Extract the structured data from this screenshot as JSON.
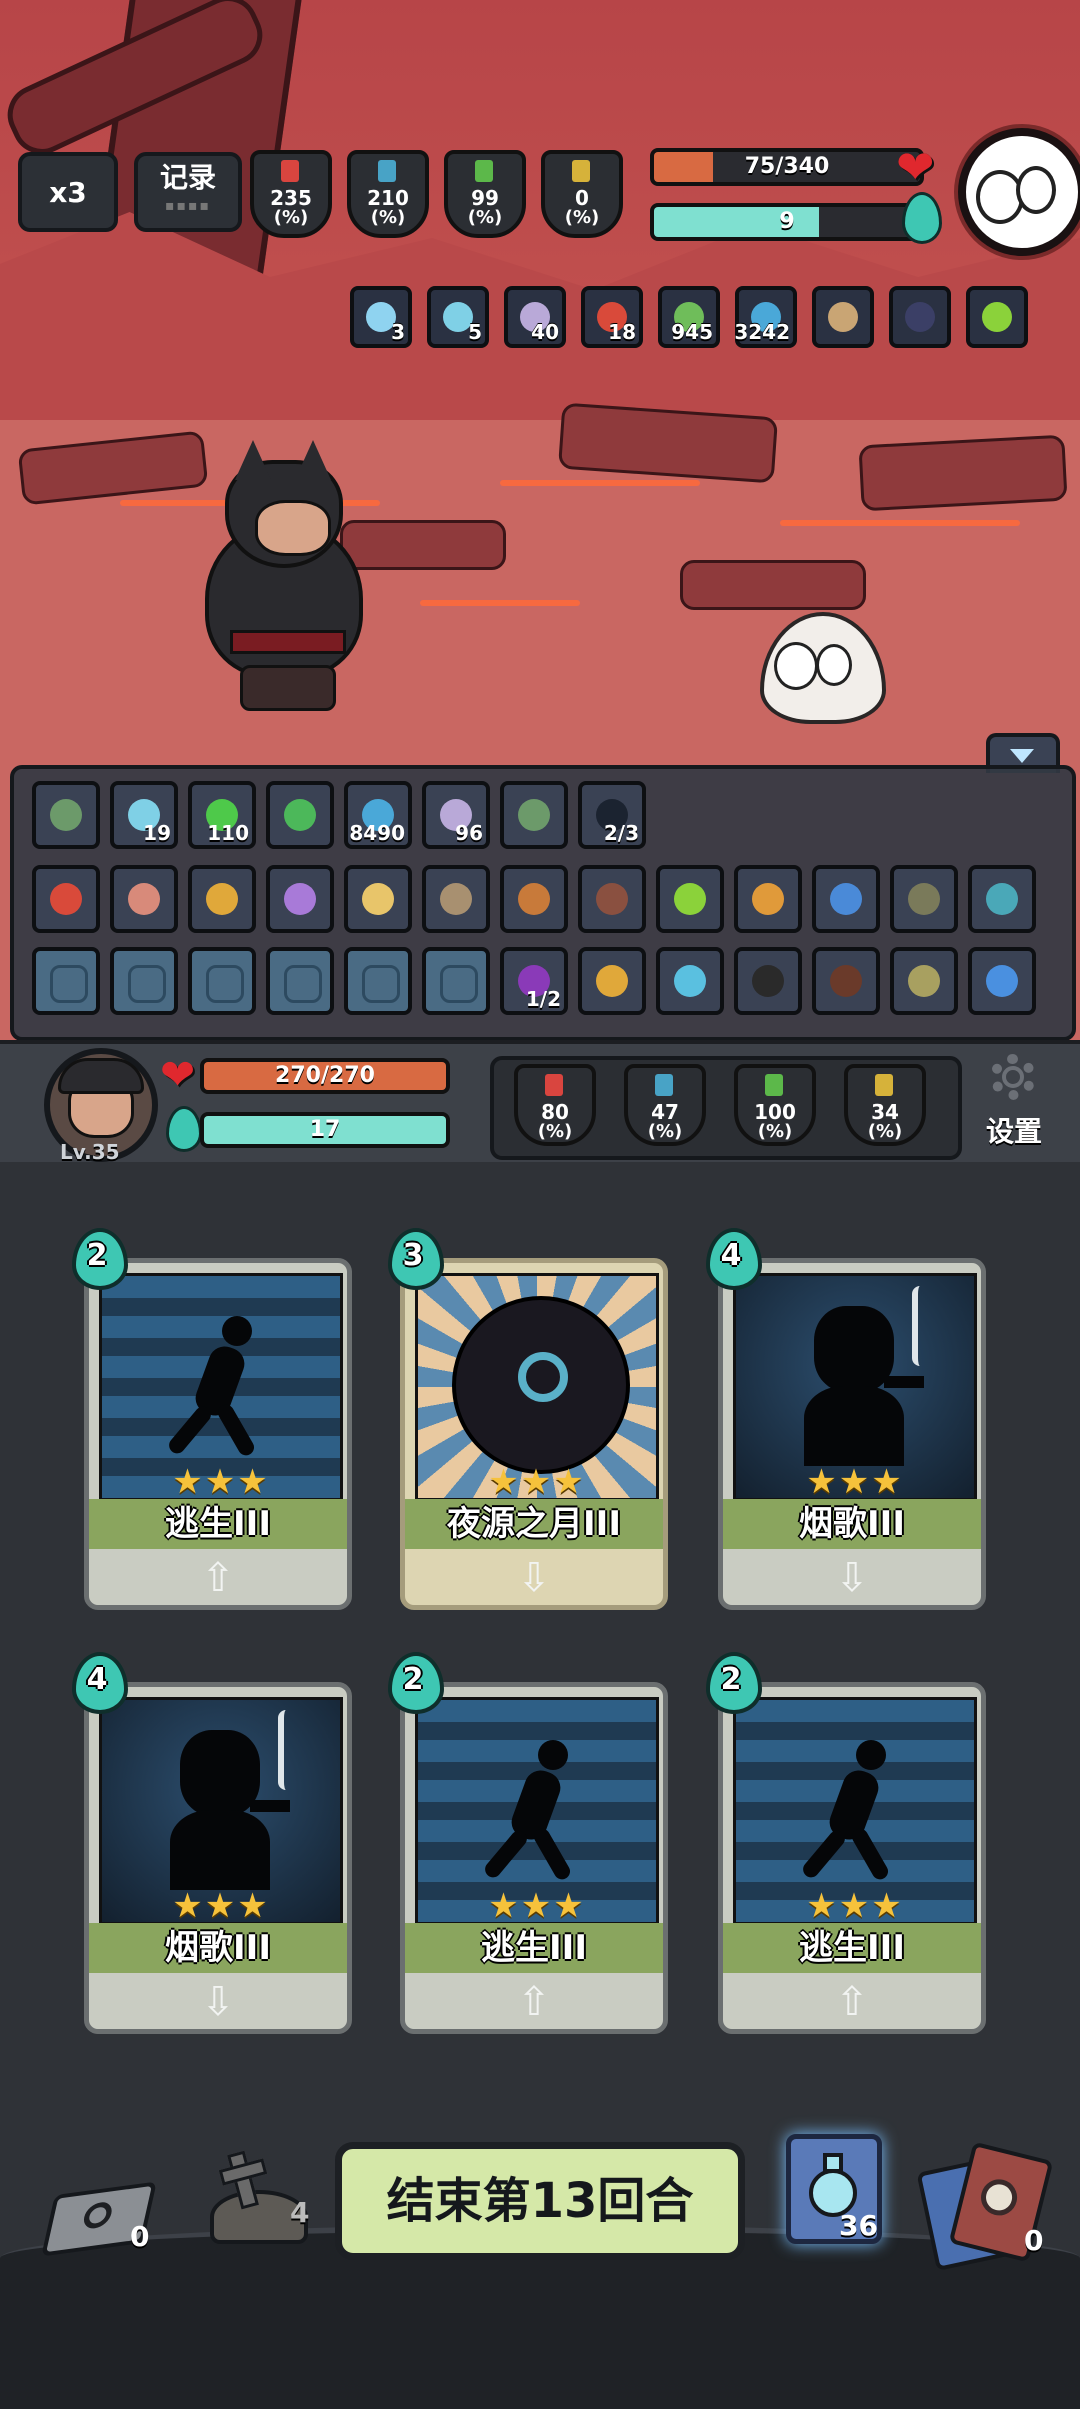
{
  "enemy": {
    "speed_button": "x3",
    "record_button": "记录",
    "stats": [
      {
        "value": "235",
        "unit": "(%)",
        "color": "#d9453f",
        "icon": "attack-icon"
      },
      {
        "value": "210",
        "unit": "(%)",
        "color": "#48a3c6",
        "icon": "crit-icon"
      },
      {
        "value": "99",
        "unit": "(%)",
        "color": "#5cb84a",
        "icon": "defense-icon"
      },
      {
        "value": "0",
        "unit": "(%)",
        "color": "#d6b23a",
        "icon": "speed-icon"
      }
    ],
    "hp": {
      "text": "75/340",
      "current": 75,
      "max": 340
    },
    "energy": {
      "text": "9",
      "fraction": 0.62
    },
    "buffs": [
      {
        "icon": "snowflake-icon",
        "count": "3",
        "color": "#8fd3f0"
      },
      {
        "icon": "crosshair-icon",
        "count": "5",
        "color": "#7fd0e6"
      },
      {
        "icon": "swirl-icon",
        "count": "40",
        "color": "#b9a9d8"
      },
      {
        "icon": "claw-icon",
        "count": "18",
        "color": "#d94a3a"
      },
      {
        "icon": "skull-icon",
        "count": "945",
        "color": "#6fbd5a"
      },
      {
        "icon": "shield-icon",
        "count": "3242",
        "color": "#4aa8d8"
      },
      {
        "icon": "scroll-icon",
        "count": "",
        "color": "#c9a574"
      },
      {
        "icon": "cloak-icon",
        "count": "",
        "color": "#3b3f66"
      },
      {
        "icon": "leaf-icon",
        "count": "",
        "color": "#8bd23a"
      }
    ]
  },
  "inventory": {
    "row1": [
      {
        "icon": "turtle-shell-icon",
        "count": "",
        "color": "#6c9a6a"
      },
      {
        "icon": "crosshair-icon",
        "count": "19",
        "color": "#7fd0e6"
      },
      {
        "icon": "green-blade-icon",
        "count": "110",
        "color": "#4ec94a"
      },
      {
        "icon": "green-glove-icon",
        "count": "",
        "color": "#4cb85a"
      },
      {
        "icon": "shield-icon",
        "count": "8490",
        "color": "#4aa8d8"
      },
      {
        "icon": "swirl-icon",
        "count": "96",
        "color": "#b9a9d8"
      },
      {
        "icon": "turtle-shell-icon",
        "count": "",
        "color": "#6c9a6a"
      },
      {
        "icon": "shadow-figure-icon",
        "count": "2/3",
        "color": "#1b2330"
      }
    ],
    "row2": [
      {
        "icon": "red-horn-icon",
        "color": "#d94a3a"
      },
      {
        "icon": "meat-icon",
        "color": "#d88a7a"
      },
      {
        "icon": "golden-horn-icon",
        "color": "#e0a83a"
      },
      {
        "icon": "crystals-icon",
        "color": "#a87ad8"
      },
      {
        "icon": "potion-bottle-icon",
        "color": "#e8c56a"
      },
      {
        "icon": "fossil-icon",
        "color": "#a89070"
      },
      {
        "icon": "cookie-icon",
        "color": "#c87a3a"
      },
      {
        "icon": "fang-icon",
        "color": "#8a5040"
      },
      {
        "icon": "leaf-icon",
        "color": "#8bd23a"
      },
      {
        "icon": "broom-icon",
        "color": "#e09a3a"
      },
      {
        "icon": "blue-horn-icon",
        "color": "#4a8ad8"
      },
      {
        "icon": "spiked-ball-icon",
        "color": "#7a7a5a"
      },
      {
        "icon": "fish-icon",
        "color": "#4aa8b8"
      }
    ],
    "row3": [
      {
        "icon": "ghost-icon",
        "count": "",
        "color": "#4a6b84"
      },
      {
        "icon": "muscle-icon",
        "count": "",
        "color": "#4a6b84"
      },
      {
        "icon": "pig-icon",
        "count": "",
        "color": "#4a6b84"
      },
      {
        "icon": "potion-icon",
        "count": "",
        "color": "#4a6b84"
      },
      {
        "icon": "skull-shield-icon",
        "count": "",
        "color": "#4a6b84"
      },
      {
        "icon": "skull-icon",
        "count": "",
        "color": "#4a6b84"
      },
      {
        "icon": "witch-icon",
        "count": "1/2",
        "color": "#8a3ab8"
      },
      {
        "icon": "flower-icon",
        "count": "",
        "color": "#e0a83a"
      },
      {
        "icon": "water-drop-icon",
        "count": "",
        "color": "#5ac0e0"
      },
      {
        "icon": "trap-icon",
        "count": "",
        "color": "#2a2a2a"
      },
      {
        "icon": "sack-icon",
        "count": "",
        "color": "#6a3a2a"
      },
      {
        "icon": "egg-icon",
        "count": "",
        "color": "#a8a060"
      },
      {
        "icon": "rune-stone-icon",
        "count": "",
        "color": "#4a90e0"
      }
    ]
  },
  "player": {
    "level": "Lv.35",
    "hp": {
      "text": "270/270",
      "current": 270,
      "max": 270
    },
    "energy": {
      "text": "17",
      "fraction": 1.0
    },
    "stats": [
      {
        "value": "80",
        "unit": "(%)",
        "color": "#d9453f",
        "icon": "attack-icon"
      },
      {
        "value": "47",
        "unit": "(%)",
        "color": "#48a3c6",
        "icon": "crit-icon"
      },
      {
        "value": "100",
        "unit": "(%)",
        "color": "#5cb84a",
        "icon": "defense-icon"
      },
      {
        "value": "34",
        "unit": "(%)",
        "color": "#d6b23a",
        "icon": "speed-icon"
      }
    ],
    "settings_label": "设置"
  },
  "cards": [
    {
      "cost": "2",
      "name": "逃生III",
      "stars": "★★★",
      "art": "runner",
      "arrow": "up"
    },
    {
      "cost": "3",
      "name": "夜源之月III",
      "stars": "★★★",
      "art": "moon",
      "arrow": "down"
    },
    {
      "cost": "4",
      "name": "烟歌III",
      "stars": "★★★",
      "art": "smoker",
      "arrow": "down"
    },
    {
      "cost": "4",
      "name": "烟歌III",
      "stars": "★★★",
      "art": "smoker",
      "arrow": "down"
    },
    {
      "cost": "2",
      "name": "逃生III",
      "stars": "★★★",
      "art": "runner",
      "arrow": "up"
    },
    {
      "cost": "2",
      "name": "逃生III",
      "stars": "★★★",
      "art": "runner",
      "arrow": "up"
    }
  ],
  "bottom": {
    "draw_pile_count": "0",
    "grave_count": "4",
    "end_turn_label": "结束第13回合",
    "potion_count": "36",
    "discard_count": "0"
  }
}
